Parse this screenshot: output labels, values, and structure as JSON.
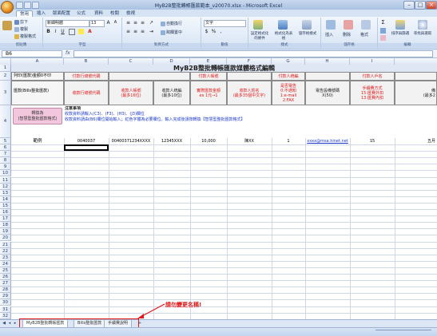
{
  "window": {
    "title": "MyB2B整批轉帳匯款範本_v20070.xlsx - Microsoft Excel"
  },
  "tabs": [
    "常用",
    "插入",
    "版面配置",
    "公式",
    "資料",
    "校閱",
    "檢視"
  ],
  "ribbon": {
    "clipboard": {
      "cut": "剪下",
      "copy": "複製",
      "format_painter": "複製格式",
      "caption": "剪貼簿"
    },
    "font": {
      "name": "新細明體",
      "size": "13",
      "caption": "字型"
    },
    "alignment": {
      "wrap": "自動換行",
      "merge": "跨欄置中",
      "caption": "對齊方式"
    },
    "number": {
      "format": "文字",
      "caption": "數值"
    },
    "styles": {
      "conditional": "設定格式化的條件",
      "table": "格式化為表格",
      "cell": "儲存格樣式",
      "caption": "樣式"
    },
    "cells": {
      "insert": "插入",
      "delete": "刪除",
      "format": "格式",
      "caption": "儲存格"
    },
    "editing": {
      "sort": "排序與篩選",
      "find": "尋找與選取",
      "caption": "編輯"
    }
  },
  "formula_bar": {
    "name_box": "B6",
    "fx": "fx",
    "content": ""
  },
  "columns": [
    "A",
    "B",
    "C",
    "D",
    "E",
    "F",
    "G",
    "H",
    "I"
  ],
  "rows": [
    "1",
    "2",
    "3",
    "4",
    "5",
    "6",
    "7",
    "8",
    "9",
    "10",
    "11",
    "12",
    "13",
    "14",
    "15",
    "16",
    "17",
    "18",
    "19",
    "20",
    "21",
    "22",
    "23",
    "24",
    "25",
    "26",
    "27",
    "28",
    "29",
    "30",
    "31",
    "32",
    "33",
    "34",
    "35"
  ],
  "sheet": {
    "title": "MyB2B整批轉帳匯款媒體格式編輯",
    "a2": "列印(匯款)金額0不印",
    "a3": "匯款(Bills整批匯款)",
    "a4_line1": "轉換為",
    "a4_line2": "(智慧型整批匯款格式)",
    "headers": {
      "b2": "付款行總號代碼",
      "b3": "收款行總號代碼",
      "c3_1": "收款人帳號",
      "c3_2": "(最多16位)",
      "d3_1": "收款人統編",
      "d3_2": "(最多10位)",
      "e2": "付款人帳號",
      "e3_1": "實際匯款金額",
      "e3_2": "ex 1元→1",
      "f3_1": "收款人姓名",
      "f3_2": "(最多35個中文字)",
      "g2": "付款人統編",
      "g3_1": "是否電告",
      "g3_2": "0:不通知",
      "g3_3": "1:e-mail",
      "g3_4": "2:FAX",
      "h3_1": "電告設備號碼",
      "h3_2": "X(50)",
      "i2": "付款人戶名",
      "i3_1": "手續費方式",
      "i3_2": "15:匯費外扣",
      "i3_3": "13:匯費內扣",
      "j3_1": "備",
      "j3_2": "(最多2"
    },
    "notes": {
      "line1": "注意事項",
      "line2": "收款資料請輸入(C3)、(F3)、(H3)、(J3)欄位",
      "line3": "收款資料請由(B6)欄位開始輸入；紅色字體為必要欄位。輸入完成後請按轉換【智慧型整批匯款格式】"
    },
    "row5": {
      "a": "範例",
      "b": "0040037",
      "c": "00400371234XXXX",
      "d": "12345XXX",
      "e": "10,000",
      "f": "陳XX",
      "g": "1",
      "h": "xxxx@msa.hinet.net",
      "i": "15",
      "j": "五月"
    }
  },
  "annotation": "請勿變更名稱!",
  "sheet_tabs": [
    "MyB2B整批轉帳匯款",
    "Bills整批匯款",
    "手續費說明"
  ],
  "colors": {
    "accent": "#1e4a8c",
    "required_red": "#e01818",
    "link_blue": "#1b39c8",
    "tab_highlight": "#e01818"
  }
}
